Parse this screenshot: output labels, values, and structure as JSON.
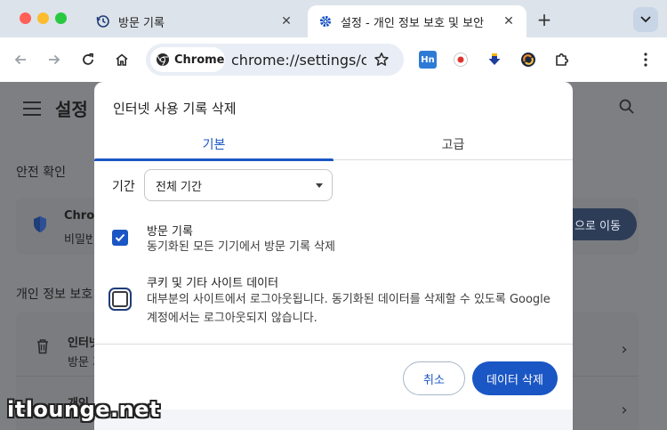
{
  "tabs": [
    {
      "label": "방문 기록",
      "icon": "history-icon"
    },
    {
      "label": "설정 - 개인 정보 보호 및 보안",
      "icon": "gear-icon"
    }
  ],
  "omnibox": {
    "chip_label": "Chrome",
    "url": "chrome://settings/c..."
  },
  "extensions": {
    "hn_label": "Hn"
  },
  "settings_page": {
    "title": "설정",
    "safety_section": "안전 확인",
    "safety_card_title": "Chrome",
    "safety_card_sub": "비밀번",
    "safety_button": "으로 이동",
    "privacy_section": "개인 정보 보호",
    "row1_title": "인터넷",
    "row1_sub": "방문 기",
    "row2_title": "개인"
  },
  "dialog": {
    "title": "인터넷 사용 기록 삭제",
    "tab_basic": "기본",
    "tab_advanced": "고급",
    "range_label": "기간",
    "range_value": "전체 기간",
    "option1_title": "방문 기록",
    "option1_desc": "동기화된 모든 기기에서 방문 기록 삭제",
    "option1_checked": true,
    "option2_title": "쿠키 및 기타 사이트 데이터",
    "option2_desc": "대부분의 사이트에서 로그아웃됩니다. 동기화된 데이터를 삭제할 수 있도록 Google 계정에서는 로그아웃되지 않습니다.",
    "option2_checked": false,
    "cancel_label": "취소",
    "delete_label": "데이터 삭제"
  },
  "watermark": "itlounge.net",
  "colors": {
    "accent": "#1a56c4",
    "scrim": "#7e7f82",
    "tabstrip": "#dde3ea"
  }
}
